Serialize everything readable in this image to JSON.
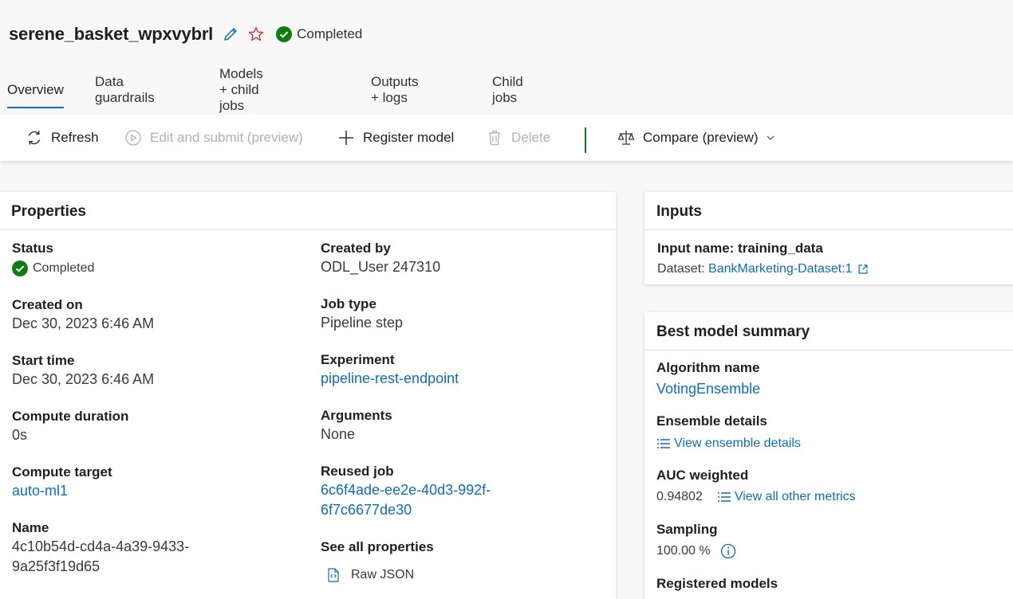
{
  "job": {
    "title": "serene_basket_wpxvybrl",
    "status": "Completed"
  },
  "tabs": [
    "Overview",
    "Data guardrails",
    "Models + child jobs",
    "Outputs + logs",
    "Child jobs"
  ],
  "toolbar": {
    "refresh": "Refresh",
    "edit_submit": "Edit and submit (preview)",
    "register_model": "Register model",
    "delete": "Delete",
    "compare": "Compare (preview)"
  },
  "properties": {
    "title": "Properties",
    "status_label": "Status",
    "status_value": "Completed",
    "created_on_label": "Created on",
    "created_on_value": "Dec 30, 2023 6:46 AM",
    "start_time_label": "Start time",
    "start_time_value": "Dec 30, 2023 6:46 AM",
    "compute_duration_label": "Compute duration",
    "compute_duration_value": "0s",
    "compute_target_label": "Compute target",
    "compute_target_value": "auto-ml1",
    "name_label": "Name",
    "name_value_line1": "4c10b54d-cd4a-4a39-9433-",
    "name_value_line2": "9a25f3f19d65",
    "created_by_label": "Created by",
    "created_by_value": "ODL_User 247310",
    "job_type_label": "Job type",
    "job_type_value": "Pipeline step",
    "experiment_label": "Experiment",
    "experiment_value": "pipeline-rest-endpoint",
    "arguments_label": "Arguments",
    "arguments_value": "None",
    "reused_job_label": "Reused job",
    "reused_job_line1": "6c6f4ade-ee2e-40d3-992f-",
    "reused_job_line2": "6f7c6677de30",
    "see_all_label": "See all properties",
    "raw_json": "Raw JSON"
  },
  "inputs": {
    "title": "Inputs",
    "input_name": "Input name: training_data",
    "dataset_label": "Dataset: ",
    "dataset_link": "BankMarketing-Dataset:1"
  },
  "best_model": {
    "title": "Best model summary",
    "algorithm_label": "Algorithm name",
    "algorithm_value": "VotingEnsemble",
    "ensemble_label": "Ensemble details",
    "ensemble_link": "View ensemble details",
    "auc_label": "AUC weighted",
    "auc_value": "0.94802",
    "metrics_link": "View all other metrics",
    "sampling_label": "Sampling",
    "sampling_value": "100.00 %",
    "registered_label": "Registered models"
  },
  "colors": {
    "accent": "#0f6cbd",
    "success": "#107c10",
    "favorite": "#d13438"
  }
}
